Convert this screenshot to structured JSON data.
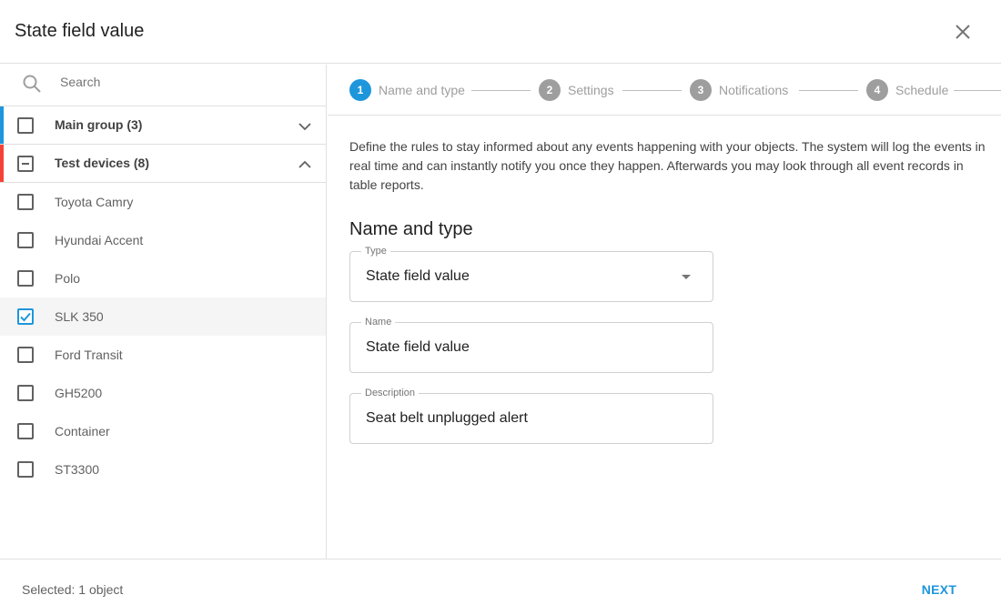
{
  "dialog": {
    "title": "State field value"
  },
  "search": {
    "placeholder": "Search"
  },
  "groups": [
    {
      "label": "Main group (3)",
      "color": "#1e96dc",
      "state": "unchecked",
      "expanded": false
    },
    {
      "label": "Test devices (8)",
      "color": "#f44336",
      "state": "indeterminate",
      "expanded": true
    }
  ],
  "devices": [
    {
      "label": "Toyota Camry",
      "checked": false
    },
    {
      "label": "Hyundai Accent",
      "checked": false
    },
    {
      "label": "Polo",
      "checked": false
    },
    {
      "label": "SLK 350",
      "checked": true
    },
    {
      "label": "Ford Transit",
      "checked": false
    },
    {
      "label": "GH5200",
      "checked": false
    },
    {
      "label": "Container",
      "checked": false
    },
    {
      "label": "ST3300",
      "checked": false
    }
  ],
  "stepper": {
    "steps": [
      {
        "number": "1",
        "label": "Name and type",
        "active": true
      },
      {
        "number": "2",
        "label": "Settings",
        "active": false
      },
      {
        "number": "3",
        "label": "Notifications",
        "active": false
      },
      {
        "number": "4",
        "label": "Schedule",
        "active": false
      }
    ]
  },
  "intro": "Define the rules to stay informed about any events happening with your objects. The system will log the events in real time and can instantly notify you once they happen. Afterwards you may look through all event records in table reports.",
  "form": {
    "section_title": "Name and type",
    "type": {
      "label": "Type",
      "value": "State field value"
    },
    "name": {
      "label": "Name",
      "value": "State field value"
    },
    "description": {
      "label": "Description",
      "value": "Seat belt unplugged alert"
    }
  },
  "footer": {
    "selected_text": "Selected: 1 object",
    "next_label": "NEXT"
  },
  "colors": {
    "accent": "#1e96dc",
    "main_group_bar": "#1e96dc",
    "test_devices_bar": "#f44336"
  },
  "icons": {
    "close": "close-icon",
    "search": "search-icon",
    "expand": "chevron-down-icon",
    "collapse": "chevron-up-icon"
  }
}
